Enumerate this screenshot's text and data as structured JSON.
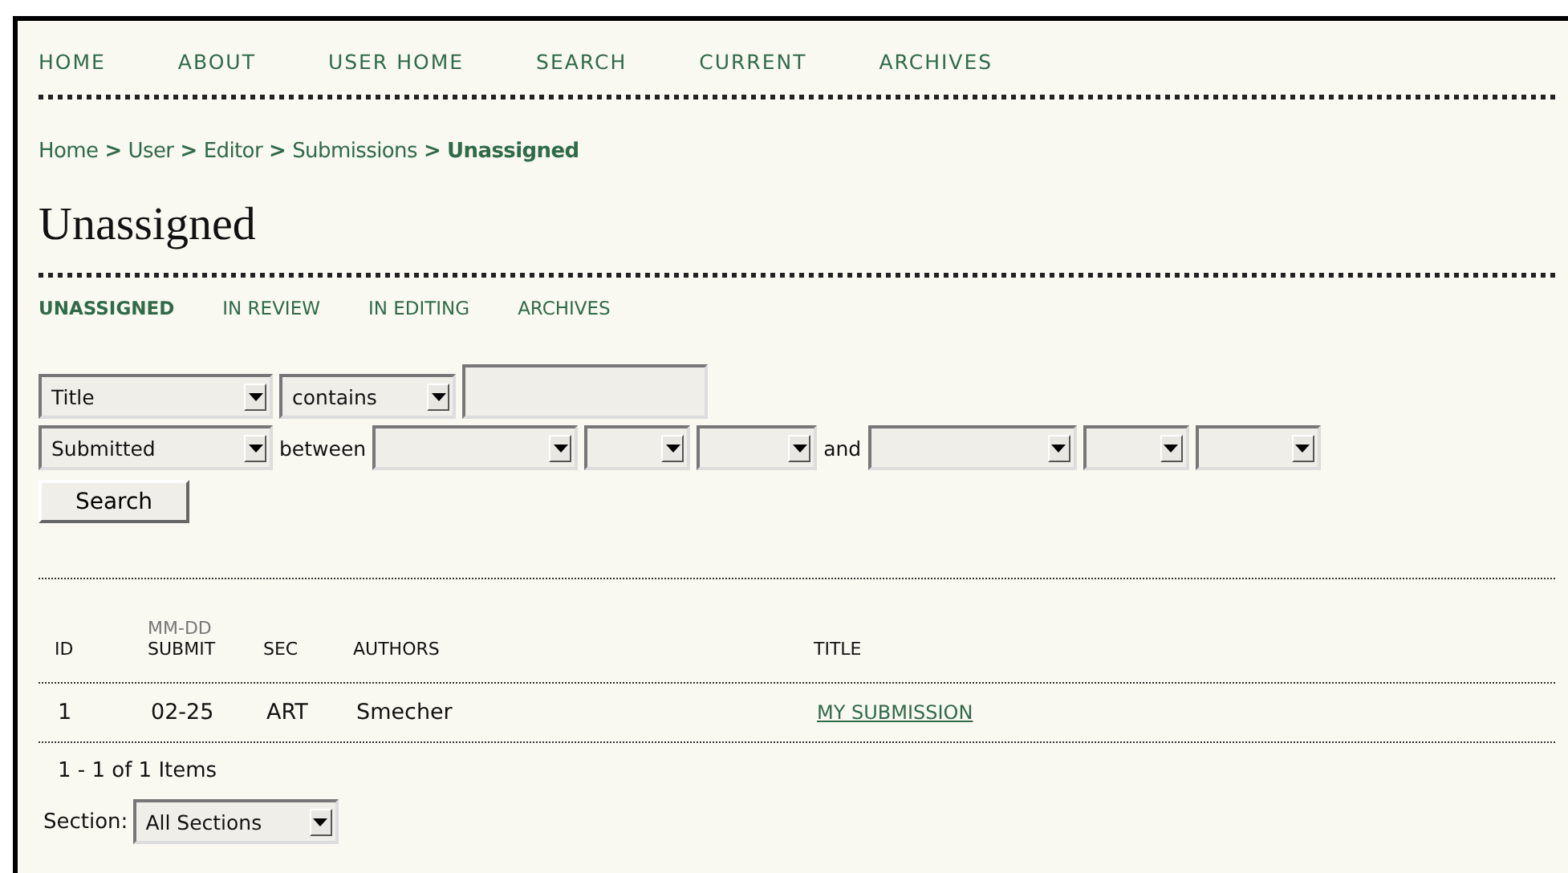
{
  "nav": [
    {
      "label": "HOME"
    },
    {
      "label": "ABOUT"
    },
    {
      "label": "USER HOME"
    },
    {
      "label": "SEARCH"
    },
    {
      "label": "CURRENT"
    },
    {
      "label": "ARCHIVES"
    }
  ],
  "breadcrumb": [
    {
      "label": "Home",
      "current": false
    },
    {
      "label": "User",
      "current": false
    },
    {
      "label": "Editor",
      "current": false
    },
    {
      "label": "Submissions",
      "current": false
    },
    {
      "label": "Unassigned",
      "current": true
    }
  ],
  "breadcrumb_separator": ">",
  "heading": "Unassigned",
  "subnav": [
    {
      "label": "UNASSIGNED",
      "selected": true
    },
    {
      "label": "IN REVIEW",
      "selected": false
    },
    {
      "label": "IN EDITING",
      "selected": false
    },
    {
      "label": "ARCHIVES",
      "selected": false
    }
  ],
  "filter_rows": [
    {
      "items": [
        {
          "kind": "select",
          "value": "Title"
        },
        {
          "kind": "select",
          "value": "contains"
        },
        {
          "kind": "input"
        }
      ]
    },
    {
      "items": [
        {
          "kind": "select",
          "value": "Submitted"
        },
        {
          "kind": "text",
          "value": "between"
        },
        {
          "kind": "select"
        },
        {
          "kind": "select"
        },
        {
          "kind": "select"
        },
        {
          "kind": "text",
          "value": "and"
        },
        {
          "kind": "select"
        },
        {
          "kind": "select"
        },
        {
          "kind": "select"
        }
      ]
    }
  ],
  "search_button": "Search",
  "table": {
    "columns": [
      {
        "label": "ID"
      },
      {
        "sublabel": "MM-DD",
        "label": "SUBMIT"
      },
      {
        "label": "SEC"
      },
      {
        "label": "AUTHORS"
      },
      {
        "label": "TITLE"
      }
    ],
    "rows": [
      {
        "cells": [
          "1",
          "02-25",
          "ART",
          "Smecher",
          "MY SUBMISSION"
        ]
      }
    ]
  },
  "item_count": "1 - 1 of 1 Items",
  "section_filter": {
    "label": "Section:",
    "value": "All Sections"
  }
}
